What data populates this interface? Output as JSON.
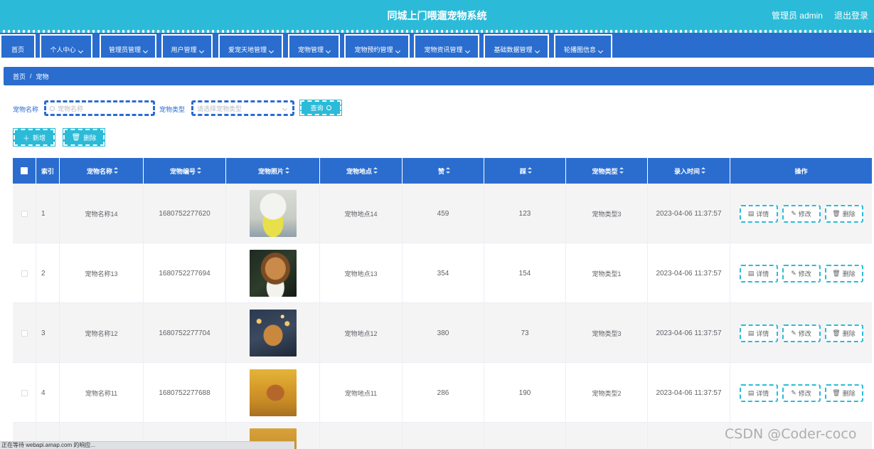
{
  "header": {
    "title": "同城上门喂遛宠物系统",
    "user_label": "管理员 admin",
    "logout_label": "退出登录"
  },
  "menu": {
    "items": [
      {
        "label": "首页",
        "has_dropdown": false
      },
      {
        "label": "个人中心",
        "has_dropdown": true
      },
      {
        "label": "管理员管理",
        "has_dropdown": true
      },
      {
        "label": "用户管理",
        "has_dropdown": true
      },
      {
        "label": "爱宠天地管理",
        "has_dropdown": true
      },
      {
        "label": "宠物管理",
        "has_dropdown": true
      },
      {
        "label": "宠物预约管理",
        "has_dropdown": true
      },
      {
        "label": "宠物资讯管理",
        "has_dropdown": true
      },
      {
        "label": "基础数据管理",
        "has_dropdown": true
      },
      {
        "label": "轮播图信息",
        "has_dropdown": true
      }
    ]
  },
  "breadcrumb": {
    "home": "首页",
    "separator": "/",
    "current": "宠物"
  },
  "search": {
    "name_label": "宠物名称",
    "name_placeholder": "宠物名称",
    "type_label": "宠物类型",
    "type_placeholder": "请选择宠物类型",
    "query_label": "查询"
  },
  "actions": {
    "add_label": "新增",
    "delete_label": "删除"
  },
  "table": {
    "columns": [
      "索引",
      "宠物名称",
      "宠物编号",
      "宠物照片",
      "宠物地点",
      "赞",
      "踩",
      "宠物类型",
      "录入时间",
      "操作"
    ],
    "rows": [
      {
        "index": "1",
        "name": "宠物名称14",
        "code": "1680752277620",
        "photo": "white-poodle-photo",
        "location": "宠物地点14",
        "likes": "459",
        "dislikes": "123",
        "type": "宠物类型3",
        "time": "2023-04-06 11:37:57"
      },
      {
        "index": "2",
        "name": "宠物名称13",
        "code": "1680752277694",
        "photo": "collie-photo",
        "location": "宠物地点13",
        "likes": "354",
        "dislikes": "154",
        "type": "宠物类型1",
        "time": "2023-04-06 11:37:57"
      },
      {
        "index": "3",
        "name": "宠物名称12",
        "code": "1680752277704",
        "photo": "dog-with-lights-photo",
        "location": "宠物地点12",
        "likes": "380",
        "dislikes": "73",
        "type": "宠物类型3",
        "time": "2023-04-06 11:37:57"
      },
      {
        "index": "4",
        "name": "宠物名称11",
        "code": "1680752277688",
        "photo": "dog-autumn-leaves-photo",
        "location": "宠物地点11",
        "likes": "286",
        "dislikes": "190",
        "type": "宠物类型2",
        "time": "2023-04-06 11:37:57"
      }
    ],
    "op_labels": {
      "detail": "详情",
      "edit": "修改",
      "delete": "删除"
    }
  },
  "statusbar": {
    "text": "正在等待 webapi.amap.com 的响应..."
  },
  "watermark": "CSDN @Coder-coco",
  "colors": {
    "header_bg": "#2bbbd8",
    "menu_bg": "#2a6dcf",
    "button_bg": "#2bbbd8",
    "row_alt_bg": "#f4f4f5"
  }
}
